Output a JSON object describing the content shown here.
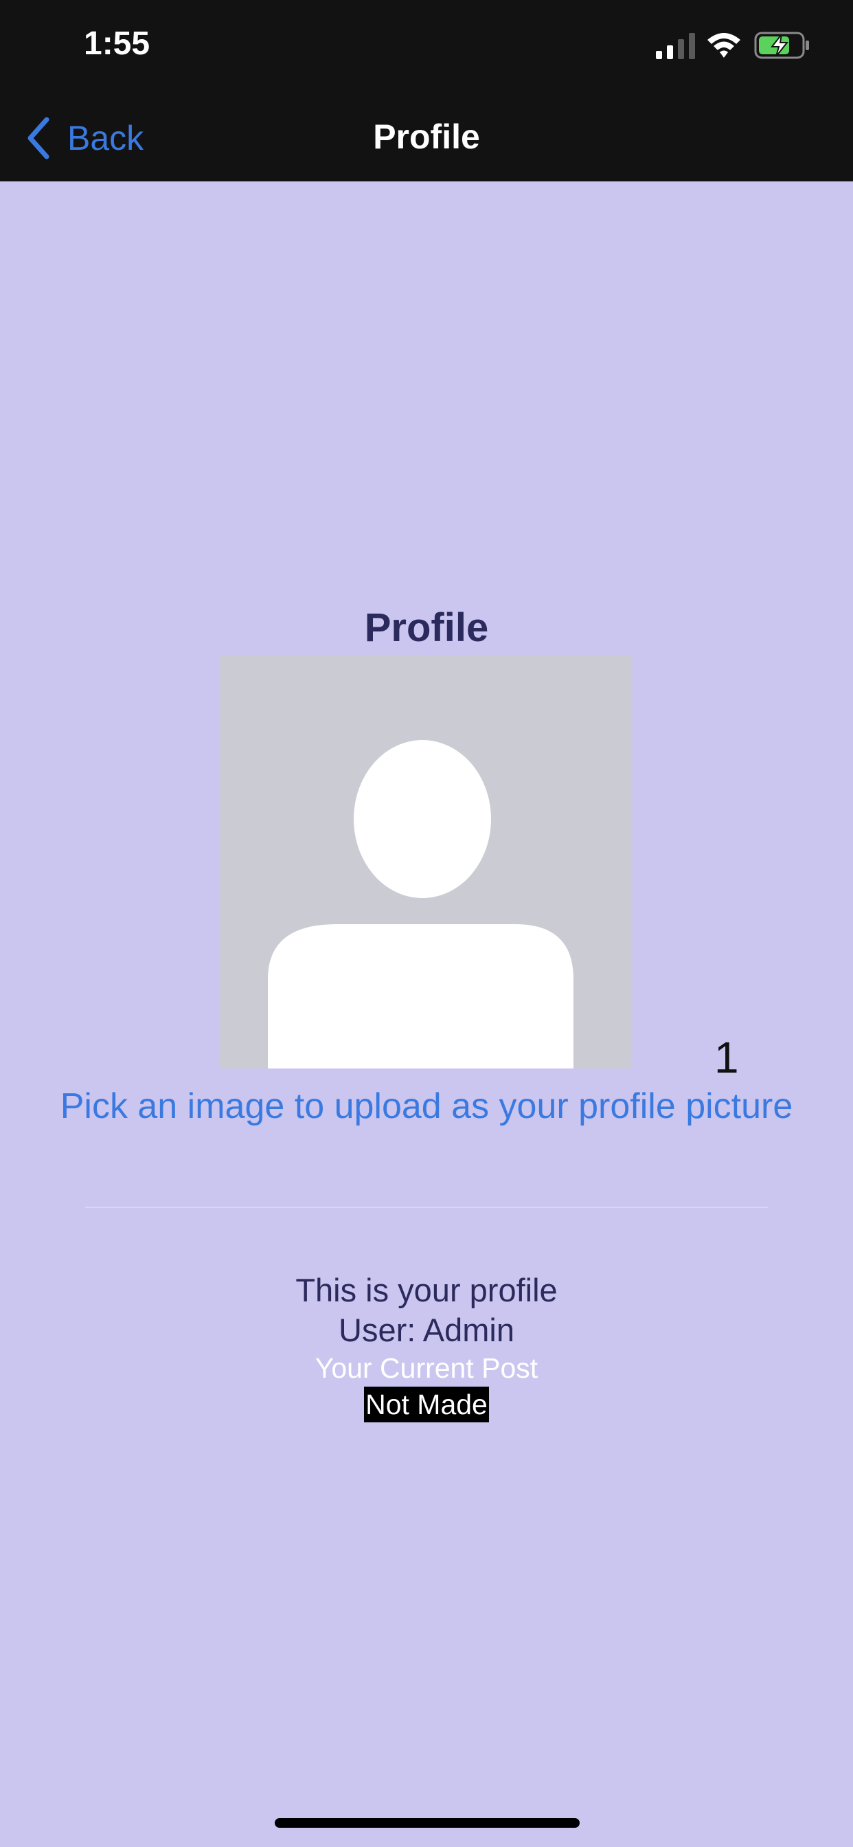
{
  "status_bar": {
    "time": "1:55",
    "icons": [
      "signal-icon",
      "wifi-icon",
      "battery-charging-icon"
    ]
  },
  "nav": {
    "back_label": "Back",
    "title": "Profile"
  },
  "content": {
    "title": "Profile",
    "avatar_icon": "default-user-avatar-icon",
    "counter": "1",
    "pick_image_label": "Pick an image to upload as your profile picture",
    "profile_text": "This is your profile",
    "user_text": "User: Admin",
    "current_post_label": "Your Current Post",
    "current_post_value": "Not Made"
  },
  "colors": {
    "background": "#cbc6f0",
    "bar_background": "#121212",
    "accent": "#3a7ae0",
    "heading": "#2b2a5c"
  }
}
